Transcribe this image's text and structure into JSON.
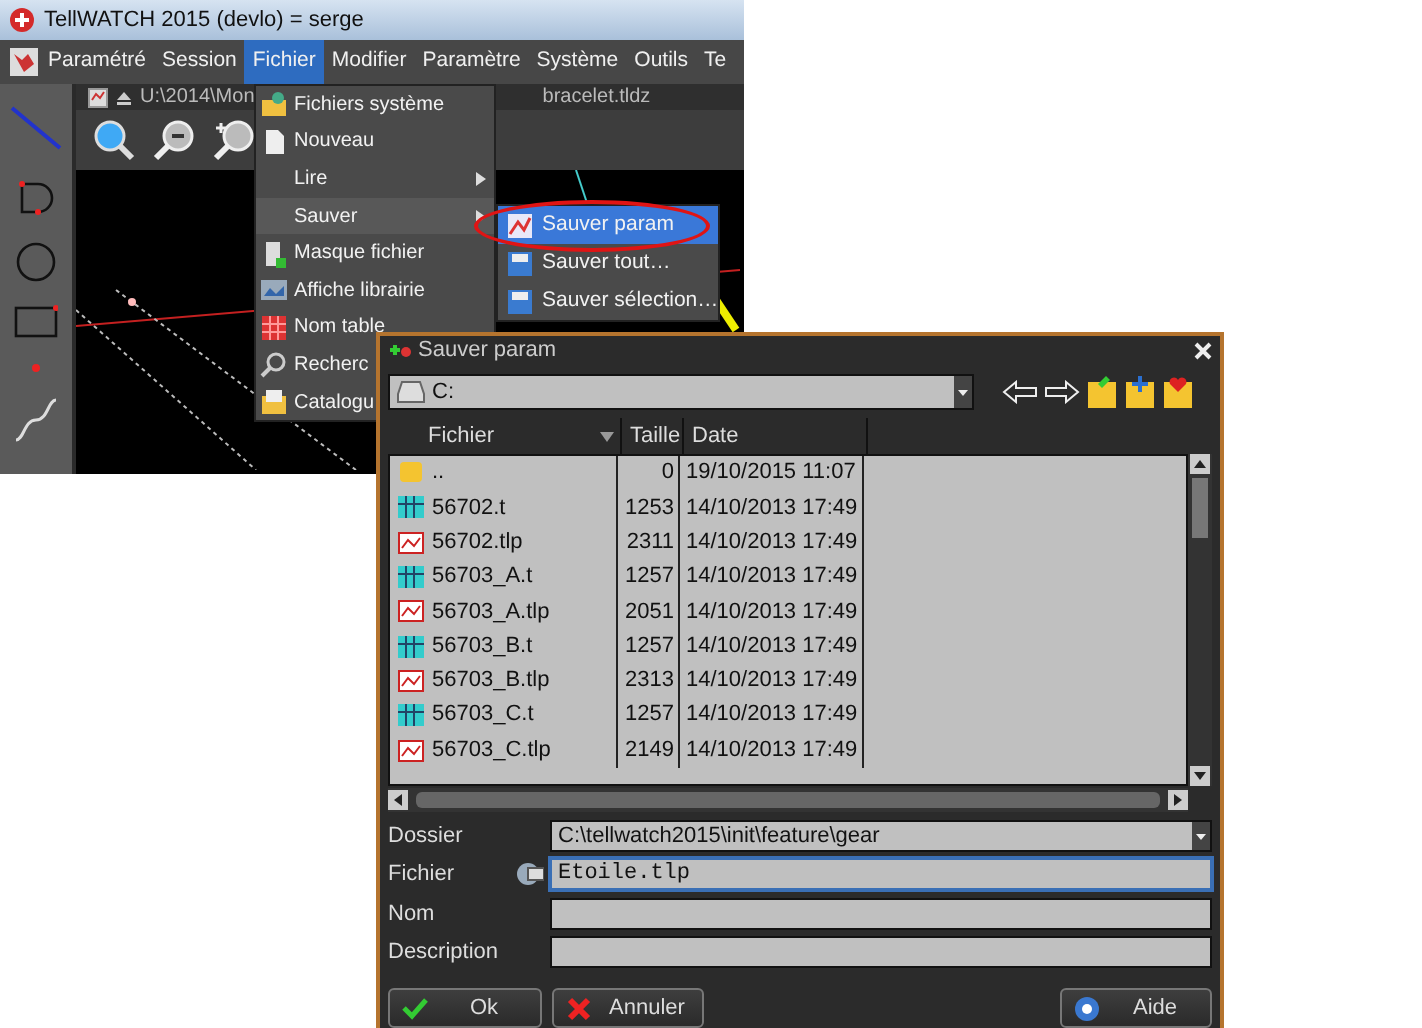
{
  "app_window": {
    "title": "TellWATCH 2015  (devlo) = serge",
    "menu": [
      {
        "label": "Paramétré",
        "selected": false
      },
      {
        "label": "Session",
        "selected": false
      },
      {
        "label": "Fichier",
        "selected": true
      },
      {
        "label": "Modifier",
        "selected": false
      },
      {
        "label": "Paramètre",
        "selected": false
      },
      {
        "label": "Système",
        "selected": false
      },
      {
        "label": "Outils",
        "selected": false
      },
      {
        "label": "Te",
        "selected": false
      }
    ],
    "document": {
      "path_left": "U:\\2014\\Mon",
      "path_right": "bracelet.tldz"
    },
    "file_menu": {
      "items": [
        {
          "label": "Fichiers système",
          "kind": "system",
          "has_submenu": false,
          "selected": false
        },
        {
          "label": "Nouveau",
          "kind": "new",
          "has_submenu": false,
          "selected": false
        },
        {
          "label": "Lire",
          "kind": "none",
          "has_submenu": true,
          "selected": false
        },
        {
          "label": "Sauver",
          "kind": "none",
          "has_submenu": true,
          "selected": true
        },
        {
          "label": "Masque fichier",
          "kind": "mask",
          "has_submenu": false,
          "selected": false
        },
        {
          "label": "Affiche librairie",
          "kind": "library",
          "has_submenu": false,
          "selected": false
        },
        {
          "label": "Nom table",
          "kind": "table",
          "has_submenu": false,
          "selected": false
        },
        {
          "label": "Recherc",
          "kind": "search",
          "has_submenu": false,
          "selected": false
        },
        {
          "label": "Catalogu",
          "kind": "catalog",
          "has_submenu": false,
          "selected": false
        }
      ]
    },
    "save_submenu": {
      "items": [
        {
          "label": "Sauver param",
          "kind": "param",
          "selected": true,
          "circled": true
        },
        {
          "label": "Sauver tout…",
          "kind": "disk",
          "selected": false,
          "circled": false
        },
        {
          "label": "Sauver sélection…",
          "kind": "disk",
          "selected": false,
          "circled": false
        }
      ]
    }
  },
  "dialog": {
    "title": "Sauver param",
    "drive": "C:",
    "columns": [
      "Fichier",
      "Taille",
      "Date"
    ],
    "rows": [
      {
        "kind": "folder",
        "name": "..",
        "size": "0",
        "date": "19/10/2015 11:07"
      },
      {
        "kind": "t",
        "name": "56702.t",
        "size": "1253",
        "date": "14/10/2013 17:49"
      },
      {
        "kind": "tlp",
        "name": "56702.tlp",
        "size": "2311",
        "date": "14/10/2013 17:49"
      },
      {
        "kind": "t",
        "name": "56703_A.t",
        "size": "1257",
        "date": "14/10/2013 17:49"
      },
      {
        "kind": "tlp",
        "name": "56703_A.tlp",
        "size": "2051",
        "date": "14/10/2013 17:49"
      },
      {
        "kind": "t",
        "name": "56703_B.t",
        "size": "1257",
        "date": "14/10/2013 17:49"
      },
      {
        "kind": "tlp",
        "name": "56703_B.tlp",
        "size": "2313",
        "date": "14/10/2013 17:49"
      },
      {
        "kind": "t",
        "name": "56703_C.t",
        "size": "1257",
        "date": "14/10/2013 17:49"
      },
      {
        "kind": "tlp",
        "name": "56703_C.tlp",
        "size": "2149",
        "date": "14/10/2013 17:49"
      }
    ],
    "fields": [
      {
        "kind": "combo",
        "label": "Dossier",
        "value": "C:\\tellwatch2015\\init\\feature\\gear",
        "focused": false
      },
      {
        "kind": "file",
        "label": "Fichier",
        "value": "Etoile.tlp",
        "focused": true
      },
      {
        "kind": "text",
        "label": "Nom",
        "focused": false
      },
      {
        "kind": "text",
        "label": "Description",
        "focused": false
      }
    ],
    "buttons": [
      {
        "kind": "ok",
        "label": "Ok"
      },
      {
        "kind": "cancel",
        "label": "Annuler"
      },
      {
        "kind": "help",
        "label": "Aide"
      }
    ]
  }
}
